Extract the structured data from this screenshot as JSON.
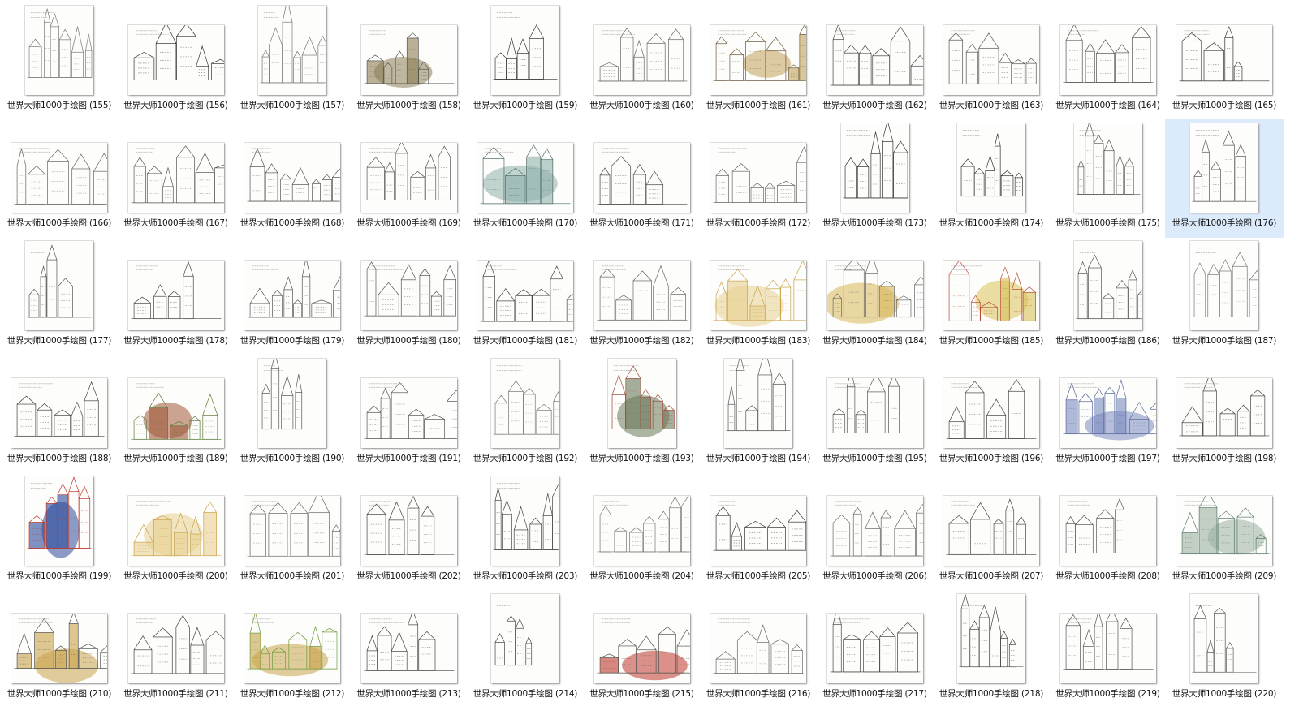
{
  "files": [
    {
      "name": "世界大师1000手绘图 (155)",
      "orient": "portrait",
      "palette": [
        "#7a7a7a"
      ]
    },
    {
      "name": "世界大师1000手绘图 (156)",
      "orient": "landscape",
      "palette": [
        "#333333"
      ]
    },
    {
      "name": "世界大师1000手绘图 (157)",
      "orient": "portrait",
      "palette": [
        "#777777"
      ]
    },
    {
      "name": "世界大师1000手绘图 (158)",
      "orient": "landscape",
      "palette": [
        "#555555",
        "#8c7d54"
      ]
    },
    {
      "name": "世界大师1000手绘图 (159)",
      "orient": "portrait",
      "palette": [
        "#333333"
      ]
    },
    {
      "name": "世界大师1000手绘图 (160)",
      "orient": "landscape",
      "palette": [
        "#666666"
      ]
    },
    {
      "name": "世界大师1000手绘图 (161)",
      "orient": "landscape",
      "palette": [
        "#6b5a3c",
        "#c2a15a"
      ]
    },
    {
      "name": "世界大师1000手绘图 (162)",
      "orient": "landscape",
      "palette": [
        "#444444"
      ]
    },
    {
      "name": "世界大师1000手绘图 (163)",
      "orient": "landscape",
      "palette": [
        "#555555"
      ]
    },
    {
      "name": "世界大师1000手绘图 (164)",
      "orient": "landscape",
      "palette": [
        "#555555"
      ]
    },
    {
      "name": "世界大师1000手绘图 (165)",
      "orient": "landscape",
      "palette": [
        "#333333"
      ]
    },
    {
      "name": "世界大师1000手绘图 (166)",
      "orient": "landscape",
      "palette": [
        "#666666"
      ]
    },
    {
      "name": "世界大师1000手绘图 (167)",
      "orient": "landscape",
      "palette": [
        "#555555"
      ]
    },
    {
      "name": "世界大师1000手绘图 (168)",
      "orient": "landscape",
      "palette": [
        "#555555"
      ]
    },
    {
      "name": "世界大师1000手绘图 (169)",
      "orient": "landscape",
      "palette": [
        "#555555"
      ]
    },
    {
      "name": "世界大师1000手绘图 (170)",
      "orient": "landscape",
      "palette": [
        "#4d6b6b",
        "#8fb0ac"
      ]
    },
    {
      "name": "世界大师1000手绘图 (171)",
      "orient": "landscape",
      "palette": [
        "#444444"
      ]
    },
    {
      "name": "世界大师1000手绘图 (172)",
      "orient": "landscape",
      "palette": [
        "#666666"
      ]
    },
    {
      "name": "世界大师1000手绘图 (173)",
      "orient": "portrait",
      "palette": [
        "#333333"
      ]
    },
    {
      "name": "世界大师1000手绘图 (174)",
      "orient": "portrait",
      "palette": [
        "#333333"
      ]
    },
    {
      "name": "世界大师1000手绘图 (175)",
      "orient": "portrait",
      "palette": [
        "#555555"
      ]
    },
    {
      "name": "世界大师1000手绘图 (176)",
      "orient": "portrait",
      "palette": [
        "#555555"
      ],
      "selected": true
    },
    {
      "name": "世界大师1000手绘图 (177)",
      "orient": "portrait",
      "palette": [
        "#555555"
      ]
    },
    {
      "name": "世界大师1000手绘图 (178)",
      "orient": "landscape",
      "palette": [
        "#444444"
      ]
    },
    {
      "name": "世界大师1000手绘图 (179)",
      "orient": "landscape",
      "palette": [
        "#555555"
      ]
    },
    {
      "name": "世界大师1000手绘图 (180)",
      "orient": "landscape",
      "palette": [
        "#555555"
      ]
    },
    {
      "name": "世界大师1000手绘图 (181)",
      "orient": "landscape",
      "palette": [
        "#444444"
      ]
    },
    {
      "name": "世界大师1000手绘图 (182)",
      "orient": "landscape",
      "palette": [
        "#666666"
      ]
    },
    {
      "name": "世界大师1000手绘图 (183)",
      "orient": "landscape",
      "palette": [
        "#c9a24a",
        "#e7d08f"
      ]
    },
    {
      "name": "世界大师1000手绘图 (184)",
      "orient": "landscape",
      "palette": [
        "#666666",
        "#d8b85a"
      ]
    },
    {
      "name": "世界大师1000手绘图 (185)",
      "orient": "landscape",
      "palette": [
        "#b84a3a",
        "#d9c25a"
      ]
    },
    {
      "name": "世界大师1000手绘图 (186)",
      "orient": "portrait",
      "palette": [
        "#555555"
      ]
    },
    {
      "name": "世界大师1000手绘图 (187)",
      "orient": "portrait",
      "palette": [
        "#777777"
      ]
    },
    {
      "name": "世界大师1000手绘图 (188)",
      "orient": "landscape",
      "palette": [
        "#444444"
      ]
    },
    {
      "name": "世界大师1000手绘图 (189)",
      "orient": "landscape",
      "palette": [
        "#5c7a3a",
        "#a05a3a"
      ]
    },
    {
      "name": "世界大师1000手绘图 (190)",
      "orient": "portrait",
      "palette": [
        "#555555"
      ]
    },
    {
      "name": "世界大师1000手绘图 (191)",
      "orient": "landscape",
      "palette": [
        "#555555"
      ]
    },
    {
      "name": "世界大师1000手绘图 (192)",
      "orient": "portrait",
      "palette": [
        "#777777"
      ]
    },
    {
      "name": "世界大师1000手绘图 (193)",
      "orient": "portrait",
      "palette": [
        "#9a4a3a",
        "#6a7a5a"
      ]
    },
    {
      "name": "世界大师1000手绘图 (194)",
      "orient": "portrait",
      "palette": [
        "#555555"
      ]
    },
    {
      "name": "世界大师1000手绘图 (195)",
      "orient": "landscape",
      "palette": [
        "#555555"
      ]
    },
    {
      "name": "世界大师1000手绘图 (196)",
      "orient": "landscape",
      "palette": [
        "#444444"
      ]
    },
    {
      "name": "世界大师1000手绘图 (197)",
      "orient": "landscape",
      "palette": [
        "#5a6a9a",
        "#7a8ac0"
      ]
    },
    {
      "name": "世界大师1000手绘图 (198)",
      "orient": "landscape",
      "palette": [
        "#444444"
      ]
    },
    {
      "name": "世界大师1000手绘图 (199)",
      "orient": "portrait",
      "palette": [
        "#c0392b",
        "#2c4a9a"
      ]
    },
    {
      "name": "世界大师1000手绘图 (200)",
      "orient": "landscape",
      "palette": [
        "#c9a24a",
        "#e7d08f"
      ]
    },
    {
      "name": "世界大师1000手绘图 (201)",
      "orient": "landscape",
      "palette": [
        "#666666"
      ]
    },
    {
      "name": "世界大师1000手绘图 (202)",
      "orient": "landscape",
      "palette": [
        "#444444"
      ]
    },
    {
      "name": "世界大师1000手绘图 (203)",
      "orient": "portrait",
      "palette": [
        "#444444"
      ]
    },
    {
      "name": "世界大师1000手绘图 (204)",
      "orient": "landscape",
      "palette": [
        "#777777"
      ]
    },
    {
      "name": "世界大师1000手绘图 (205)",
      "orient": "landscape",
      "palette": [
        "#333333"
      ]
    },
    {
      "name": "世界大师1000手绘图 (206)",
      "orient": "landscape",
      "palette": [
        "#666666"
      ]
    },
    {
      "name": "世界大师1000手绘图 (207)",
      "orient": "landscape",
      "palette": [
        "#444444"
      ]
    },
    {
      "name": "世界大师1000手绘图 (208)",
      "orient": "landscape",
      "palette": [
        "#555555"
      ]
    },
    {
      "name": "世界大师1000手绘图 (209)",
      "orient": "landscape",
      "palette": [
        "#5a7a6a",
        "#9ab0a0"
      ]
    },
    {
      "name": "世界大师1000手绘图 (210)",
      "orient": "landscape",
      "palette": [
        "#555555",
        "#c9a24a"
      ]
    },
    {
      "name": "世界大师1000手绘图 (211)",
      "orient": "landscape",
      "palette": [
        "#444444"
      ]
    },
    {
      "name": "世界大师1000手绘图 (212)",
      "orient": "landscape",
      "palette": [
        "#6a9a3a",
        "#c9a24a"
      ]
    },
    {
      "name": "世界大师1000手绘图 (213)",
      "orient": "landscape",
      "palette": [
        "#444444"
      ]
    },
    {
      "name": "世界大师1000手绘图 (214)",
      "orient": "portrait",
      "palette": [
        "#444444"
      ]
    },
    {
      "name": "世界大师1000手绘图 (215)",
      "orient": "landscape",
      "palette": [
        "#555555",
        "#c0392b"
      ]
    },
    {
      "name": "世界大师1000手绘图 (216)",
      "orient": "landscape",
      "palette": [
        "#666666"
      ]
    },
    {
      "name": "世界大师1000手绘图 (217)",
      "orient": "landscape",
      "palette": [
        "#444444"
      ]
    },
    {
      "name": "世界大师1000手绘图 (218)",
      "orient": "portrait",
      "palette": [
        "#444444"
      ]
    },
    {
      "name": "世界大师1000手绘图 (219)",
      "orient": "landscape",
      "palette": [
        "#555555"
      ]
    },
    {
      "name": "世界大师1000手绘图 (220)",
      "orient": "portrait",
      "palette": [
        "#555555"
      ]
    }
  ]
}
